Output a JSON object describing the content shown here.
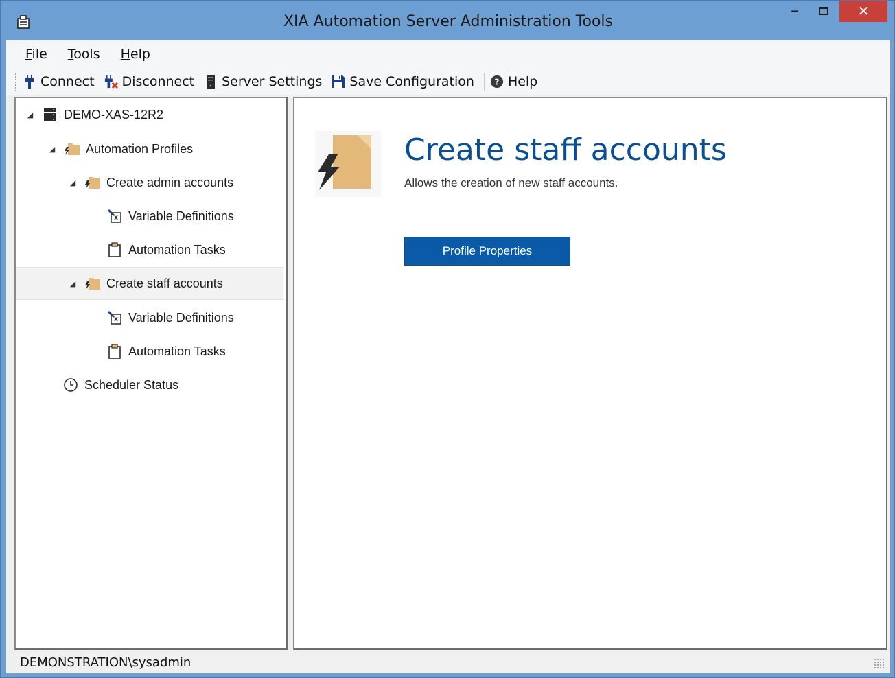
{
  "window": {
    "title": "XIA Automation Server Administration Tools",
    "minimize_glyph": "–",
    "close_glyph": "✕",
    "icon": "app-icon"
  },
  "menubar": {
    "items": [
      {
        "label": "File",
        "accel": "F",
        "rest": "ile"
      },
      {
        "label": "Tools",
        "accel": "T",
        "rest": "ools"
      },
      {
        "label": "Help",
        "accel": "H",
        "rest": "elp"
      }
    ]
  },
  "toolbar": {
    "items": [
      {
        "label": "Connect",
        "icon": "plug-icon"
      },
      {
        "label": "Disconnect",
        "icon": "unplug-icon"
      },
      {
        "label": "Server Settings",
        "icon": "server-icon"
      },
      {
        "label": "Save Configuration",
        "icon": "save-icon"
      },
      {
        "label": "Help",
        "icon": "help-icon"
      }
    ]
  },
  "tree": {
    "nodes": [
      {
        "label": "DEMO-XAS-12R2",
        "icon": "server-icon",
        "expanded": true
      },
      {
        "label": "Automation Profiles",
        "icon": "profiles-folder-icon",
        "expanded": true
      },
      {
        "label": "Create admin accounts",
        "icon": "profile-folder-icon",
        "expanded": true
      },
      {
        "label": "Variable Definitions",
        "icon": "variable-icon"
      },
      {
        "label": "Automation Tasks",
        "icon": "clipboard-icon"
      },
      {
        "label": "Create staff accounts",
        "icon": "profile-folder-icon",
        "expanded": true,
        "selected": true
      },
      {
        "label": "Variable Definitions",
        "icon": "variable-icon"
      },
      {
        "label": "Automation Tasks",
        "icon": "clipboard-icon"
      },
      {
        "label": "Scheduler Status",
        "icon": "clock-icon"
      }
    ]
  },
  "content": {
    "title": "Create staff accounts",
    "description": "Allows the creation of new staff accounts.",
    "button_label": "Profile Properties"
  },
  "status": {
    "user": "DEMONSTRATION\\sysadmin"
  },
  "colors": {
    "accent": "#0b5aa8",
    "title_blue": "#0a4f96",
    "frame": "#6e9fd3",
    "close": "#c7403a",
    "folder": "#e3b878"
  }
}
